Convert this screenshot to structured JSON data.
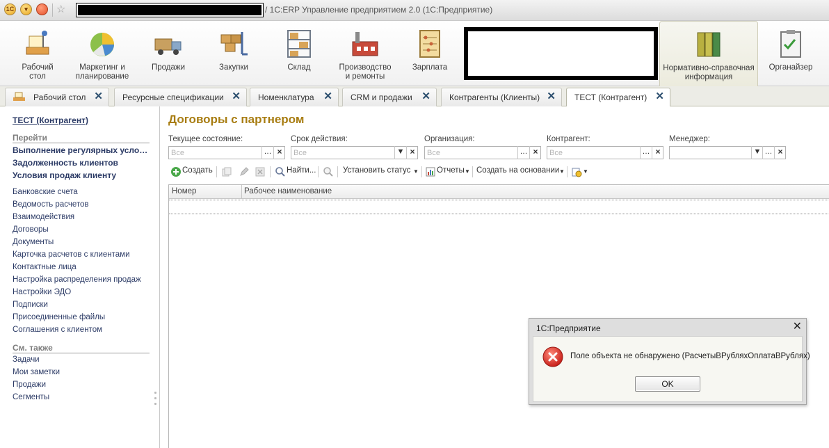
{
  "window": {
    "title": "/ 1С:ERP Управление предприятием 2.0  (1С:Предприятие)"
  },
  "sections": [
    {
      "label": "Рабочий\nстол",
      "icon": "desk-icon"
    },
    {
      "label": "Маркетинг и\nпланирование",
      "icon": "pie-chart-icon"
    },
    {
      "label": "Продажи",
      "icon": "truck-icon"
    },
    {
      "label": "Закупки",
      "icon": "cart-icon"
    },
    {
      "label": "Склад",
      "icon": "shelves-icon"
    },
    {
      "label": "Производство\nи ремонты",
      "icon": "factory-icon"
    },
    {
      "label": "Зарплата",
      "icon": "abacus-icon"
    },
    {
      "label": "Нормативно-справочная\nинформация",
      "icon": "binders-icon"
    },
    {
      "label": "Органайзер",
      "icon": "clipboard-icon"
    }
  ],
  "tabs": [
    {
      "label": "Рабочий стол"
    },
    {
      "label": "Ресурсные спецификации"
    },
    {
      "label": "Номенклатура"
    },
    {
      "label": "CRM и продажи"
    },
    {
      "label": "Контрагенты (Клиенты)"
    },
    {
      "label": "ТЕСТ (Контрагент)"
    }
  ],
  "nav": {
    "title": "ТЕСТ (Контрагент)",
    "goto_header": "Перейти",
    "goto_items": [
      "Выполнение регулярных условий",
      "Задолженность клиентов",
      "Условия продаж клиенту"
    ],
    "links": [
      "Банковские счета",
      "Ведомость расчетов",
      "Взаимодействия",
      "Договоры",
      "Документы",
      "Карточка расчетов с клиентами",
      "Контактные лица",
      "Настройка распределения продаж",
      "Настройки ЭДО",
      "Подписки",
      "Присоединенные файлы",
      "Соглашения с клиентом"
    ],
    "see_also_header": "См. также",
    "see_also": [
      "Задачи",
      "Мои заметки",
      "Продажи",
      "Сегменты"
    ]
  },
  "main": {
    "title": "Договоры с партнером",
    "filters": [
      {
        "label": "Текущее состояние:",
        "placeholder": "Все"
      },
      {
        "label": "Срок действия:",
        "placeholder": "Все"
      },
      {
        "label": "Организация:",
        "placeholder": "Все"
      },
      {
        "label": "Контрагент:",
        "placeholder": "Все"
      },
      {
        "label": "Менеджер:",
        "placeholder": ""
      }
    ],
    "toolbar": {
      "create": "Создать",
      "find": "Найти...",
      "set_status": "Установить статус",
      "reports": "Отчеты",
      "create_based": "Создать на основании"
    },
    "columns": [
      "Номер",
      "Рабочее наименование"
    ]
  },
  "dialog": {
    "title": "1С:Предприятие",
    "message": "Поле объекта не обнаружено (РасчетыВРубляхОплатаВРублях)",
    "ok": "OK"
  }
}
